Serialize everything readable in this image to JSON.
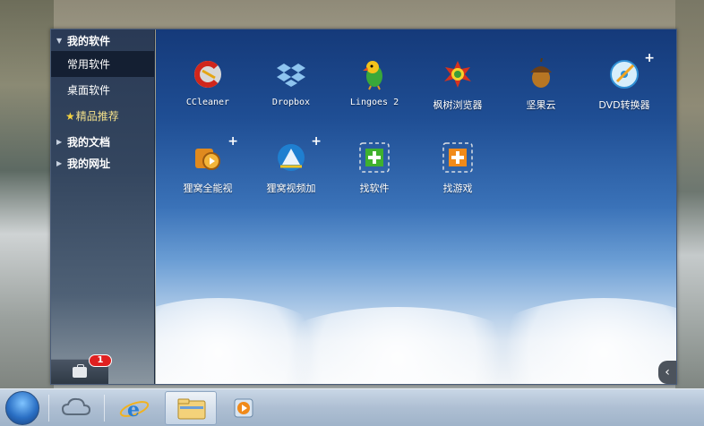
{
  "sidebar": {
    "groups": [
      {
        "label": "我的软件",
        "expanded": true
      },
      {
        "label": "我的文档",
        "expanded": false
      },
      {
        "label": "我的网址",
        "expanded": false
      }
    ],
    "items": [
      {
        "label": "常用软件",
        "active": true
      },
      {
        "label": "桌面软件",
        "active": false
      },
      {
        "label": "精品推荐",
        "active": false,
        "icon": "star-icon"
      }
    ],
    "toolbox": {
      "icon": "toolbox-icon",
      "badge": "1"
    }
  },
  "apps": [
    {
      "label": "CCleaner",
      "icon": "ccleaner-icon",
      "has_plus": false
    },
    {
      "label": "Dropbox",
      "icon": "dropbox-icon",
      "has_plus": false
    },
    {
      "label": "Lingoes 2",
      "icon": "lingoes-parrot-icon",
      "has_plus": false
    },
    {
      "label": "枫树浏览器",
      "icon": "maple-browser-icon",
      "has_plus": false
    },
    {
      "label": "坚果云",
      "icon": "acorn-icon",
      "has_plus": false
    },
    {
      "label": "DVD转换器",
      "icon": "dvd-converter-icon",
      "has_plus": true
    },
    {
      "label": "狸窝全能视",
      "icon": "leawo-video-converter-icon",
      "has_plus": true
    },
    {
      "label": "狸窝视频加",
      "icon": "leawo-video-add-icon",
      "has_plus": true
    },
    {
      "label": "找软件",
      "icon": "find-software-plus-icon",
      "has_plus": false
    },
    {
      "label": "找游戏",
      "icon": "find-games-plus-icon",
      "has_plus": false
    }
  ],
  "plus_mark": "+",
  "collapse_arrow": "‹",
  "taskbar": {
    "items": [
      "start-orb-icon",
      "cloud-icon",
      "internet-explorer-icon",
      "file-explorer-icon",
      "media-player-icon"
    ]
  },
  "colors": {
    "sidebar_active": "#141f32",
    "featured_text": "#f3e08a",
    "badge": "#e02020",
    "find_software_plus": "#3fb12e",
    "find_games_plus": "#f08a1a"
  }
}
